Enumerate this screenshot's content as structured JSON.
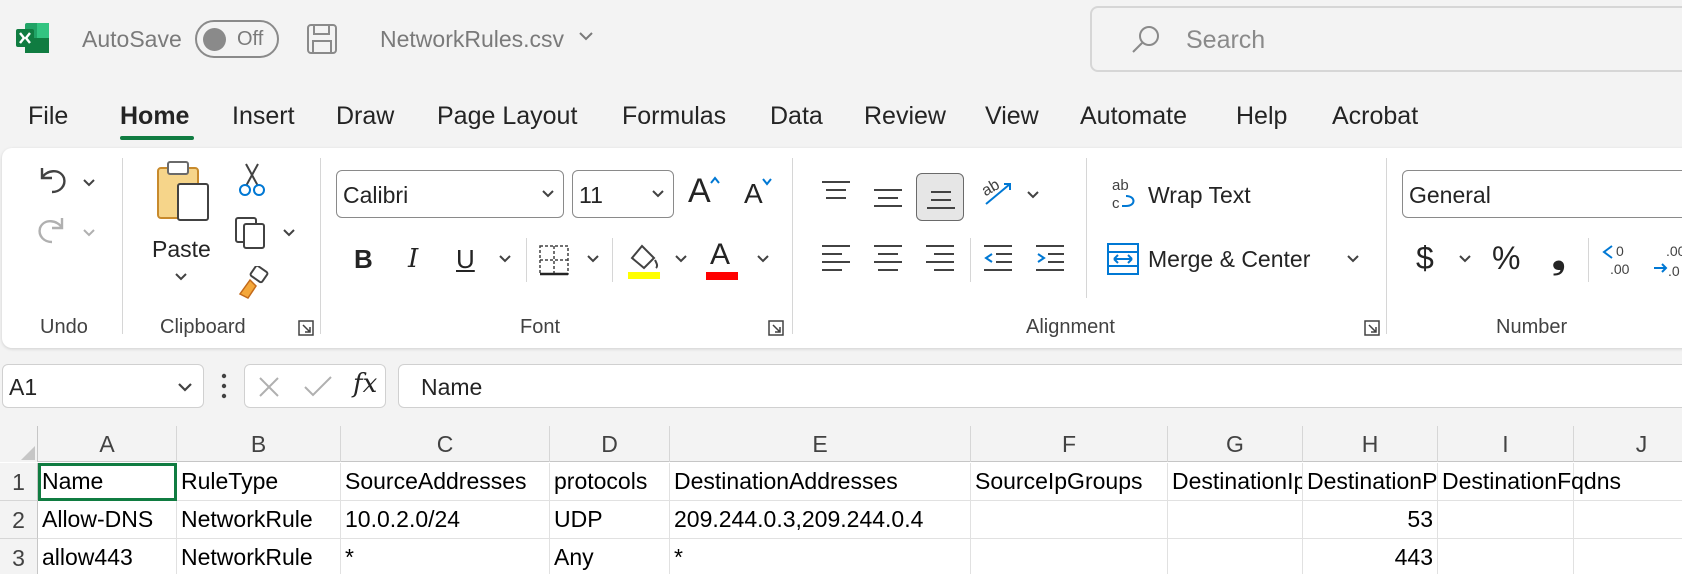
{
  "titlebar": {
    "autosave_label": "AutoSave",
    "autosave_state": "Off",
    "filename": "NetworkRules.csv",
    "search_placeholder": "Search",
    "app_icon": "excel-logo-icon",
    "brand_color": "#107c41"
  },
  "tabs": [
    "File",
    "Home",
    "Insert",
    "Draw",
    "Page Layout",
    "Formulas",
    "Data",
    "Review",
    "View",
    "Automate",
    "Help",
    "Acrobat"
  ],
  "active_tab": "Home",
  "ribbon": {
    "groups": {
      "undo": "Undo",
      "clipboard": "Clipboard",
      "font": "Font",
      "alignment": "Alignment",
      "number": "Number"
    },
    "paste_label": "Paste",
    "font_name": "Calibri",
    "font_size": "11",
    "wrap_text": "Wrap Text",
    "merge_center": "Merge & Center",
    "number_format": "General",
    "bold": "B",
    "italic": "I",
    "underline": "U",
    "font_color_letter": "A",
    "grow_font": "A",
    "shrink_font": "A",
    "currency": "$",
    "percent": "%",
    "comma": "❟",
    "highlight_color": "#ffff00",
    "font_color": "#ff0000"
  },
  "formula_bar": {
    "name_box": "A1",
    "fx": "fx",
    "content": "Name"
  },
  "sheet": {
    "columns": [
      "A",
      "B",
      "C",
      "D",
      "E",
      "F",
      "G",
      "H",
      "I",
      "J"
    ],
    "row_numbers": [
      "1",
      "2",
      "3"
    ],
    "rows": [
      [
        "Name",
        "RuleType",
        "SourceAddresses",
        "protocols",
        "DestinationAddresses",
        "SourceIpGroups",
        "DestinationIpGroups",
        "DestinationPorts",
        "DestinationFqdns",
        ""
      ],
      [
        "Allow-DNS",
        "NetworkRule",
        "10.0.2.0/24",
        "UDP",
        "209.244.0.3,209.244.0.4",
        "",
        "",
        "53",
        "",
        ""
      ],
      [
        "allow443",
        "NetworkRule",
        "*",
        "Any",
        "*",
        "",
        "",
        "443",
        "",
        ""
      ]
    ]
  }
}
